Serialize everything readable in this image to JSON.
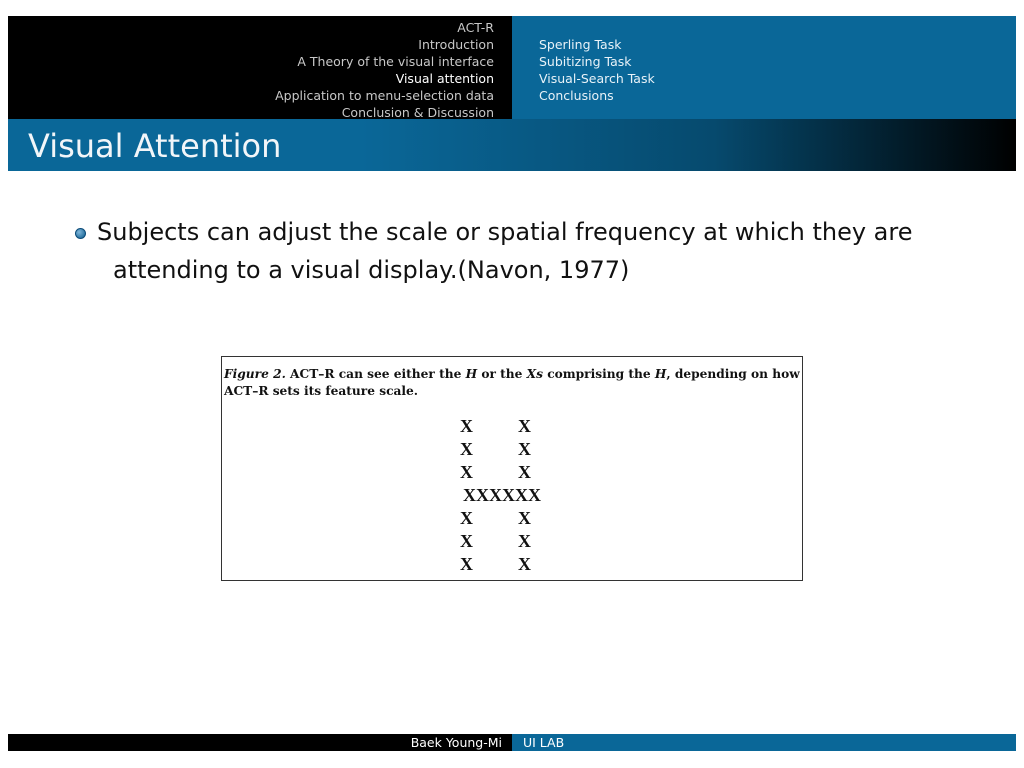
{
  "header": {
    "sections": [
      "ACT-R",
      "Introduction",
      "A Theory of the visual interface",
      "Visual attention",
      "Application to menu-selection data",
      "Conclusion & Discussion"
    ],
    "active_section": "Visual attention",
    "subsections": [
      "Sperling Task",
      "Subitizing Task",
      "Visual-Search Task",
      "Conclusions"
    ]
  },
  "slide": {
    "title": "Visual Attention",
    "bullet_line1": "Subjects can adjust the scale or spatial frequency at which they are",
    "bullet_line2": "attending to a visual display.(Navon, 1977)"
  },
  "figure": {
    "label": "Figure 2.",
    "caption_part1": " ACT–R can see either the ",
    "caption_h1": "H",
    "caption_part2": " or the ",
    "caption_xs": "X",
    "caption_s": "s",
    "caption_part3": " comprising the ",
    "caption_h2": "H",
    "caption_part4": ", depending on how",
    "caption_line2": "ACT–R sets its feature scale.",
    "rows": [
      "X          X",
      "X          X",
      "X          X",
      "XXXXXX",
      "X          X",
      "X          X",
      "X          X"
    ]
  },
  "footer": {
    "author": "Baek Young-Mi",
    "lab": "UI LAB"
  },
  "colors": {
    "accent": "#0a6798",
    "dark": "#000000"
  }
}
